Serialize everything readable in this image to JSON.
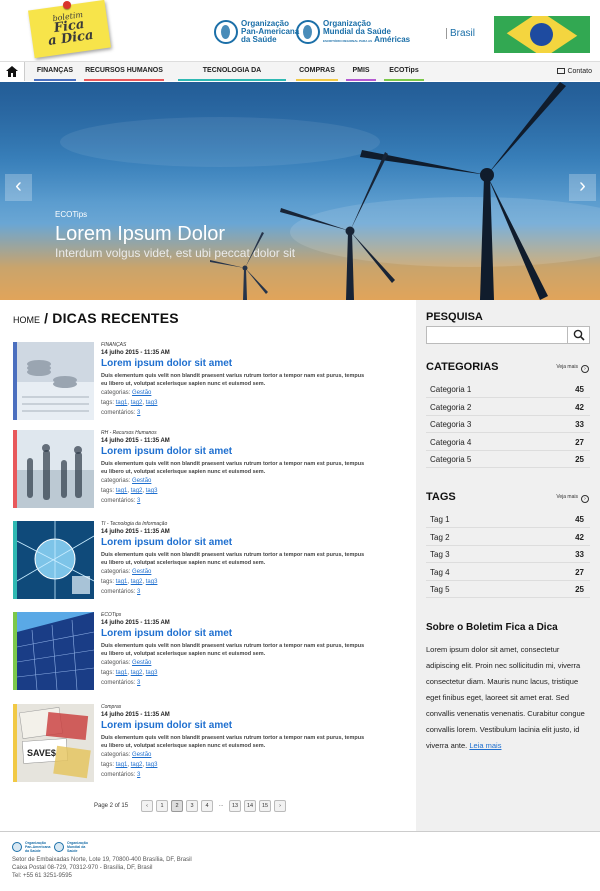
{
  "header": {
    "logo": {
      "line1": "boletim",
      "line2": "Fica",
      "line3": "a Dica"
    },
    "org1": {
      "line1": "Organização",
      "line2": "Pan-Americana",
      "line3": "da Saúde"
    },
    "org2": {
      "line1": "Organização",
      "line2": "Mundial da Saúde",
      "line3": "Américas",
      "small": "ESCRITÓRIO REGIONAL PARA AS"
    },
    "country": "Brasil",
    "flag_colors": {
      "green": "#32a852",
      "yellow": "#f4d53f",
      "blue": "#1e4ba0"
    }
  },
  "nav": {
    "home_icon": "home-icon",
    "items": [
      {
        "label": "FINANÇAS",
        "color": "#4b6fbf"
      },
      {
        "label": "RECURSOS HUMANOS",
        "color": "#e8585b"
      },
      {
        "label": "TECNOLOGIA DA INFORMAÇÃO",
        "color": "#2fb9b3"
      },
      {
        "label": "COMPRAS",
        "color": "#f1c945"
      },
      {
        "label": "PMIS",
        "color": "#b45ad0"
      },
      {
        "label": "ECOTips",
        "color": "#7cc84a"
      }
    ],
    "contact": "Contato"
  },
  "hero": {
    "label": "ECOTips",
    "title": "Lorem Ipsum Dolor",
    "subtitle": "Interdum volgus videt, est ubi peccat dolor sit",
    "prev": "‹",
    "next": "›"
  },
  "breadcrumb": {
    "home": "HOME",
    "sep": " / ",
    "current": "DICAS RECENTES"
  },
  "posts": [
    {
      "category": "FINANÇAS",
      "date": "14 julho 2015 - 11:35 AM",
      "title": "Lorem ipsum dolor sit amet",
      "excerpt": "Duis elementum quis velit non blandit praesent varius rutrum tortor a tempor nam est purus, tempus eu libero ut, volutpat scelerisque sapien nunc et euismod sem.",
      "categorias_label": "categorias:",
      "categorias_value": "Gestão",
      "tags_label": "tags:",
      "tags": [
        "tag1",
        "tag2",
        "tag3"
      ],
      "comments_label": "comentários:",
      "comments": "3",
      "accent": "#4b6fbf"
    },
    {
      "category": "RH - Recursos Humanos",
      "date": "14 julho 2015 - 11:35 AM",
      "title": "Lorem ipsum dolor sit amet",
      "excerpt": "Duis elementum quis velit non blandit praesent varius rutrum tortor a tempor nam est purus, tempus eu libero ut, volutpat scelerisque sapien nunc et euismod sem.",
      "categorias_label": "categorias:",
      "categorias_value": "Gestão",
      "tags_label": "tags:",
      "tags": [
        "tag1",
        "tag2",
        "tag3"
      ],
      "comments_label": "comentários:",
      "comments": "3",
      "accent": "#e8585b"
    },
    {
      "category": "TI - Tecnologia da Informação",
      "date": "14 julho 2015 - 11:35 AM",
      "title": "Lorem ipsum dolor sit amet",
      "excerpt": "Duis elementum quis velit non blandit praesent varius rutrum tortor a tempor nam est purus, tempus eu libero ut, volutpat scelerisque sapien nunc et euismod sem.",
      "categorias_label": "categorias:",
      "categorias_value": "Gestão",
      "tags_label": "tags:",
      "tags": [
        "tag1",
        "tag2",
        "tag3"
      ],
      "comments_label": "comentários:",
      "comments": "3",
      "accent": "#2fb9b3"
    },
    {
      "category": "ECOTips",
      "date": "14 julho 2015 - 11:35 AM",
      "title": "Lorem ipsum dolor sit amet",
      "excerpt": "Duis elementum quis velit non blandit praesent varius rutrum tortor a tempor nam est purus, tempus eu libero ut, volutpat scelerisque sapien nunc et euismod sem.",
      "categorias_label": "categorias:",
      "categorias_value": "Gestão",
      "tags_label": "tags:",
      "tags": [
        "tag1",
        "tag2",
        "tag3"
      ],
      "comments_label": "comentários:",
      "comments": "3",
      "accent": "#7cc84a"
    },
    {
      "category": "Compras",
      "date": "14 julho 2015 - 11:35 AM",
      "title": "Lorem ipsum dolor sit amet",
      "excerpt": "Duis elementum quis velit non blandit praesent varius rutrum tortor a tempor nam est purus, tempus eu libero ut, volutpat scelerisque sapien nunc et euismod sem.",
      "categorias_label": "categorias:",
      "categorias_value": "Gestão",
      "tags_label": "tags:",
      "tags": [
        "tag1",
        "tag2",
        "tag3"
      ],
      "comments_label": "comentários:",
      "comments": "3",
      "accent": "#f1c945"
    }
  ],
  "pager": {
    "label": "Page 2 of 15",
    "prev": "‹",
    "pages": [
      "1",
      "2",
      "3",
      "4"
    ],
    "current": "2",
    "ellipsis": "···",
    "tail": [
      "13",
      "14",
      "15"
    ],
    "next": "›"
  },
  "sidebar": {
    "search_title": "PESQUISA",
    "search_placeholder": "",
    "categories_title": "CATEGORIAS",
    "categories_more": "Veja mais",
    "categories": [
      {
        "name": "Categoria 1",
        "count": "45"
      },
      {
        "name": "Categoria 2",
        "count": "42"
      },
      {
        "name": "Categoria 3",
        "count": "33"
      },
      {
        "name": "Categoria 4",
        "count": "27"
      },
      {
        "name": "Categoria 5",
        "count": "25"
      }
    ],
    "tags_title": "TAGS",
    "tags_more": "Veja mais",
    "tags": [
      {
        "name": "Tag 1",
        "count": "45"
      },
      {
        "name": "Tag 2",
        "count": "42"
      },
      {
        "name": "Tag 3",
        "count": "33"
      },
      {
        "name": "Tag 4",
        "count": "27"
      },
      {
        "name": "Tag 5",
        "count": "25"
      }
    ],
    "about_title": "Sobre o Boletim Fica a Dica",
    "about_text": "Lorem ipsum dolor sit amet, consectetur adipiscing elit. Proin nec sollicitudin mi, viverra consectetur diam. Mauris nunc lacus, tristique eget finibus eget, laoreet sit amet erat. Sed convallis venenatis venenatis. Curabitur congue convallis lorem. Vestibulum lacinia elit justo, id viverra ante.",
    "about_link": "Leia mais"
  },
  "footer": {
    "org1": "Organização Pan-Americana da Saúde",
    "org2": "Organização Mundial da Saúde",
    "address1": "Setor de Embaixadas Norte, Lote 19, 70800-400 Brasília, DF, Brasil",
    "address2": "Caixa Postal 08-729, 70312-970 - Brasília, DF, Brasil",
    "phone": "Tel: +55 61 3251-9595"
  }
}
